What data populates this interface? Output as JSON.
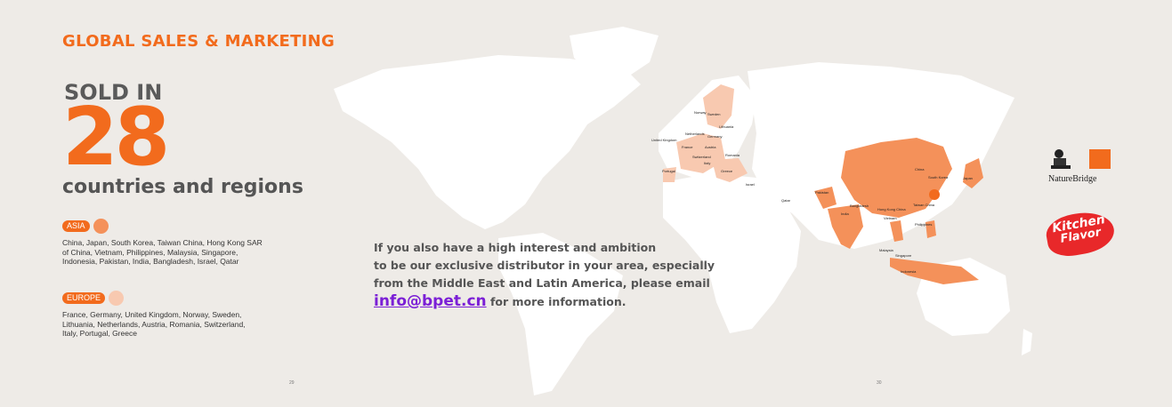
{
  "header": {
    "title": "GLOBAL SALES & MARKETING"
  },
  "hero": {
    "sold_in": "SOLD IN",
    "count": "28",
    "subtitle": "countries and regions"
  },
  "regions": [
    {
      "tag": "ASIA",
      "color": "#f4915a",
      "lines": [
        "China, Japan, South Korea, Taiwan China, Hong Kong SAR",
        "of China, Vietnam, Philippines, Malaysia, Singapore,",
        "Indonesia, Pakistan, India, Bangladesh, Israel, Qatar"
      ]
    },
    {
      "tag": "EUROPE",
      "color": "#f8c9b0",
      "lines": [
        "France, Germany, United Kingdom, Norway, Sweden,",
        "Lithuania, Netherlands, Austria, Romania, Switzerland,",
        "Italy, Portugal, Greece"
      ]
    }
  ],
  "message": {
    "line1": "If you also have a high interest and ambition",
    "line2": "to be our exclusive distributor in your area, especially",
    "line3": "from the Middle East and Latin America, please email",
    "email": "info@bpet.cn",
    "tail": " for more  information."
  },
  "page_numbers": {
    "left": "29",
    "right": "30"
  },
  "brands": {
    "nature_bridge": "NatureBridge",
    "kitchen_flavor_1": "Kitchen",
    "kitchen_flavor_2": "Flavor"
  },
  "map_labels": {
    "norway": "Norway",
    "sweden": "Sweden",
    "lithuania": "Lithuania",
    "netherlands": "Netherlands",
    "germany": "Germany",
    "uk": "United Kingdom",
    "france": "France",
    "austria": "Austria",
    "romania": "Romania",
    "switzerland": "Switzerland",
    "italy": "Italy",
    "portugal": "Portugal",
    "greece": "Greece",
    "israel": "Israel",
    "qatar": "Qatar",
    "pakistan": "Pakistan",
    "india": "India",
    "bangladesh": "Bangladesh",
    "china": "China",
    "south_korea": "South Korea",
    "japan": "Japan",
    "taiwan": "Taiwan China",
    "hongkong": "Hong Kong China",
    "vietnam": "Vietnam",
    "philippines": "Philippines",
    "malaysia": "Malaysia",
    "singapore": "Singapore",
    "indonesia": "Indonesia"
  },
  "colors": {
    "accent": "#f26b1d",
    "asia": "#f4915a",
    "europe": "#f8c9b0",
    "map_land": "#ffffff",
    "email": "#7b1fd6"
  }
}
